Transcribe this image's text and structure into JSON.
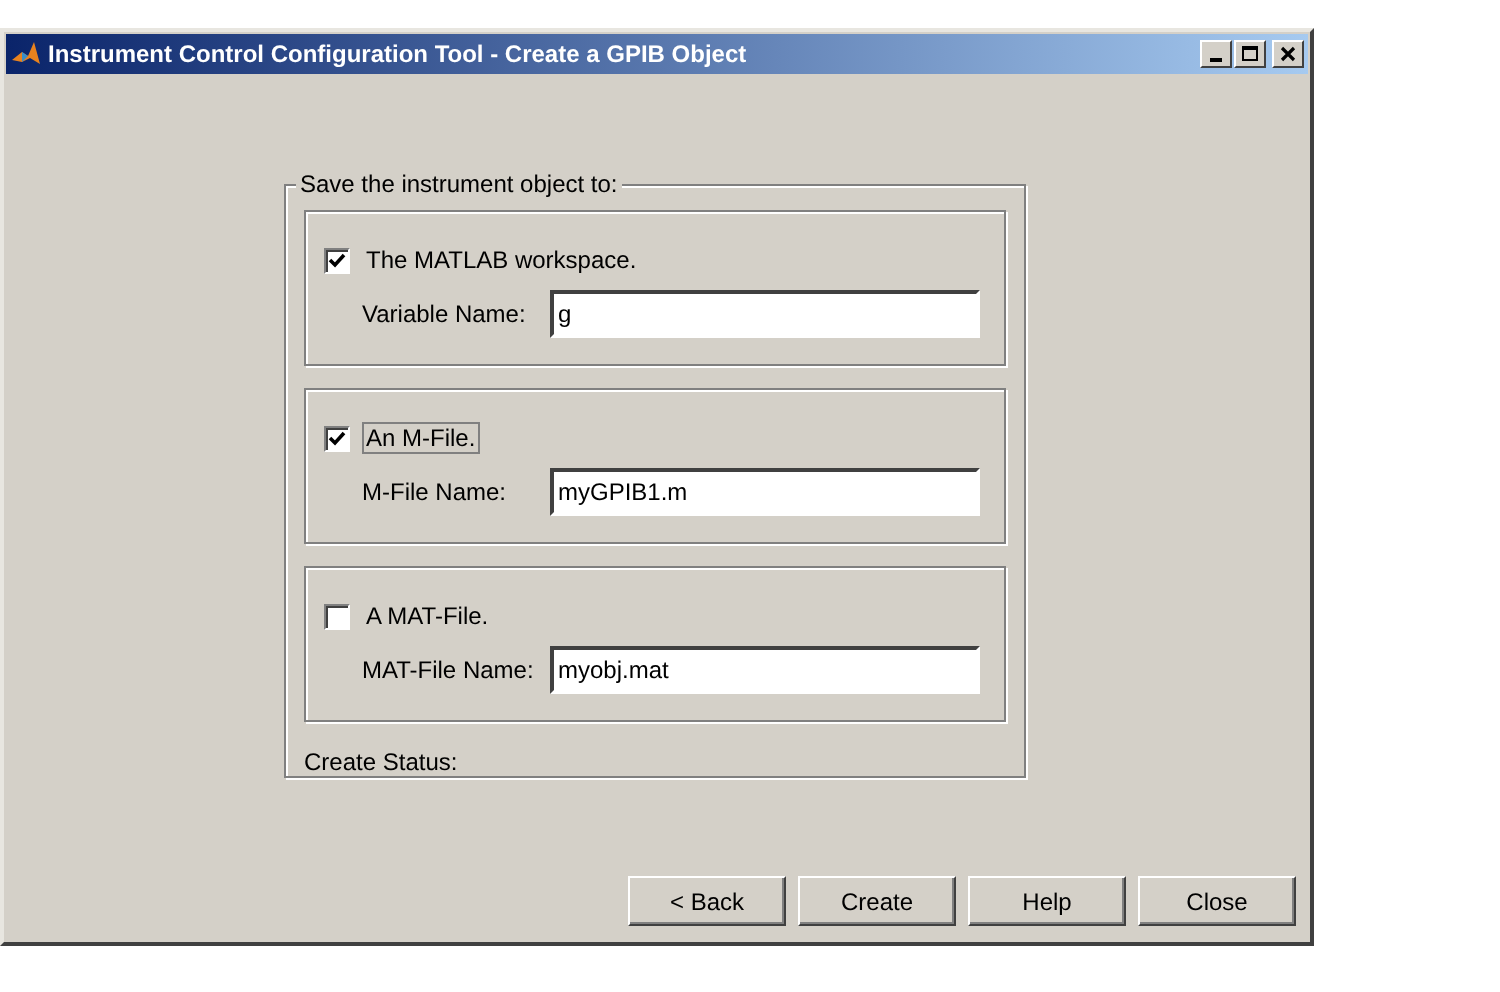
{
  "window": {
    "title": "Instrument Control Configuration Tool - Create a GPIB Object"
  },
  "save_group": {
    "legend": "Save the instrument object to:",
    "sections": [
      {
        "kind": "checkbox",
        "label": "The MATLAB workspace.",
        "checked": true,
        "focused": false,
        "field_label": "Variable Name:",
        "value": "g"
      },
      {
        "kind": "checkbox",
        "label": "An M-File.",
        "checked": true,
        "focused": true,
        "field_label": "M-File Name:",
        "value": "myGPIB1.m"
      },
      {
        "kind": "checkbox",
        "label": "A MAT-File.",
        "checked": false,
        "focused": false,
        "field_label": "MAT-File Name:",
        "value": "myobj.mat"
      }
    ],
    "status_label": "Create Status:"
  },
  "buttons": [
    "< Back",
    "Create",
    "Help",
    "Close"
  ]
}
